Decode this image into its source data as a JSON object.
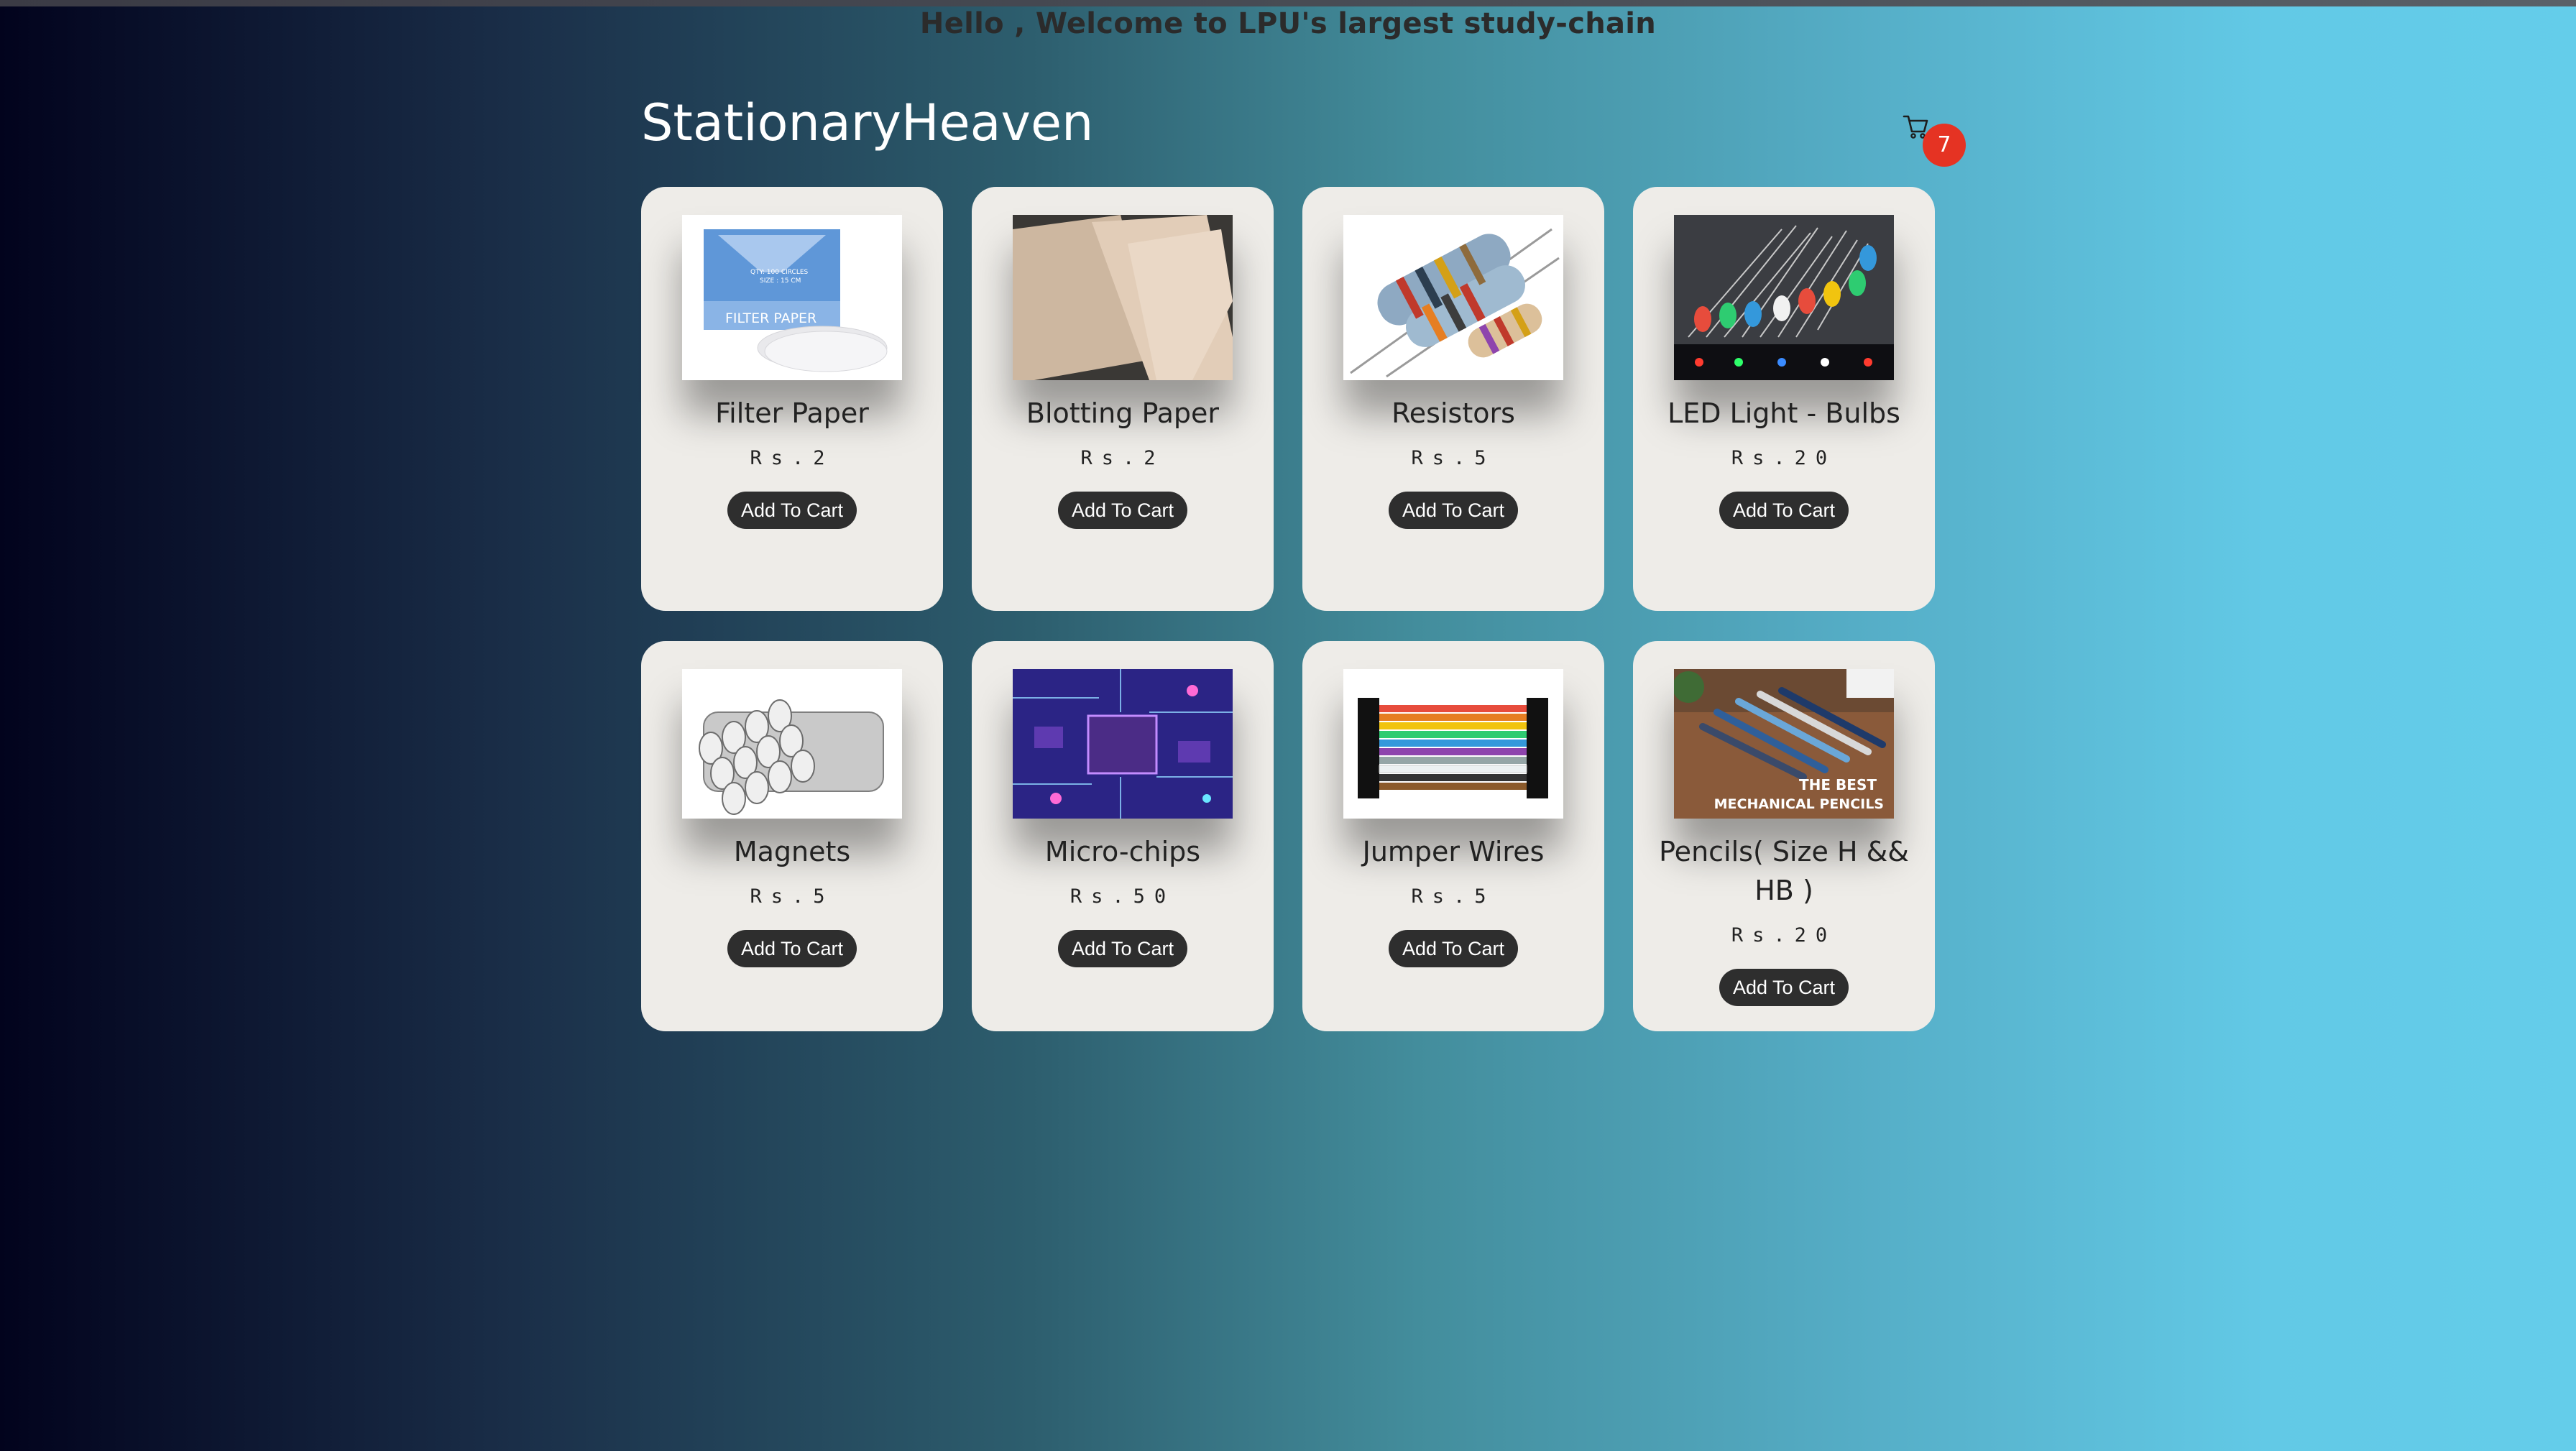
{
  "banner": {
    "welcome": "Hello , Welcome to LPU's largest study-chain"
  },
  "header": {
    "brand": "StationaryHeaven",
    "cart_count": "7",
    "cart_icon": "shopping-cart-icon"
  },
  "products": [
    {
      "name": "Filter Paper",
      "price": "Rs.2",
      "button": "Add To Cart",
      "image_text_1": "FILTER PAPER",
      "image_text_2": "QTY: 100 CIRCLES",
      "image_text_3": "SIZE : 15 CM"
    },
    {
      "name": "Blotting Paper",
      "price": "Rs.2",
      "button": "Add To Cart"
    },
    {
      "name": "Resistors",
      "price": "Rs.5",
      "button": "Add To Cart"
    },
    {
      "name": "LED Light - Bulbs",
      "price": "Rs.20",
      "button": "Add To Cart"
    },
    {
      "name": "Magnets",
      "price": "Rs.5",
      "button": "Add To Cart"
    },
    {
      "name": "Micro-chips",
      "price": "Rs.50",
      "button": "Add To Cart"
    },
    {
      "name": "Jumper Wires",
      "price": "Rs.5",
      "button": "Add To Cart"
    },
    {
      "name": "Pencils( Size H && HB )",
      "price": "Rs.20",
      "button": "Add To Cart",
      "image_text_1": "THE BEST",
      "image_text_2": "MECHANICAL PENCILS"
    }
  ],
  "colors": {
    "card_bg": "#eeece8",
    "button_bg": "#2e2e2e",
    "badge": "#e53323"
  }
}
